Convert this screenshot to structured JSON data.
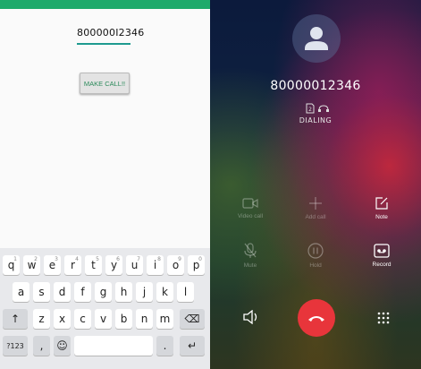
{
  "left_app": {
    "phone_input_value": "800000I2346",
    "make_call_label": "MAKE CALL!!"
  },
  "keyboard": {
    "row1": [
      {
        "key": "q",
        "hint": "1"
      },
      {
        "key": "w",
        "hint": "2"
      },
      {
        "key": "e",
        "hint": "3"
      },
      {
        "key": "r",
        "hint": "4"
      },
      {
        "key": "t",
        "hint": "5"
      },
      {
        "key": "y",
        "hint": "6"
      },
      {
        "key": "u",
        "hint": "7"
      },
      {
        "key": "i",
        "hint": "8"
      },
      {
        "key": "o",
        "hint": "9"
      },
      {
        "key": "p",
        "hint": "0"
      }
    ],
    "row2": [
      "a",
      "s",
      "d",
      "f",
      "g",
      "h",
      "j",
      "k",
      "l"
    ],
    "row3": [
      "z",
      "x",
      "c",
      "v",
      "b",
      "n",
      "m"
    ],
    "shift_key": "↑",
    "backspace_key": "⌫",
    "symbols_key": "?123",
    "comma_key": ",",
    "emoji_key": "☺",
    "period_key": ".",
    "enter_key": "↵"
  },
  "call_screen": {
    "number": "80000012346",
    "status": "DIALING",
    "controls": {
      "video_call": "Video call",
      "add_call": "Add call",
      "note": "Note",
      "mute": "Mute",
      "hold": "Hold",
      "record": "Record"
    }
  },
  "colors": {
    "accent_green": "#1eaa6b",
    "end_call_red": "#e8353b"
  }
}
